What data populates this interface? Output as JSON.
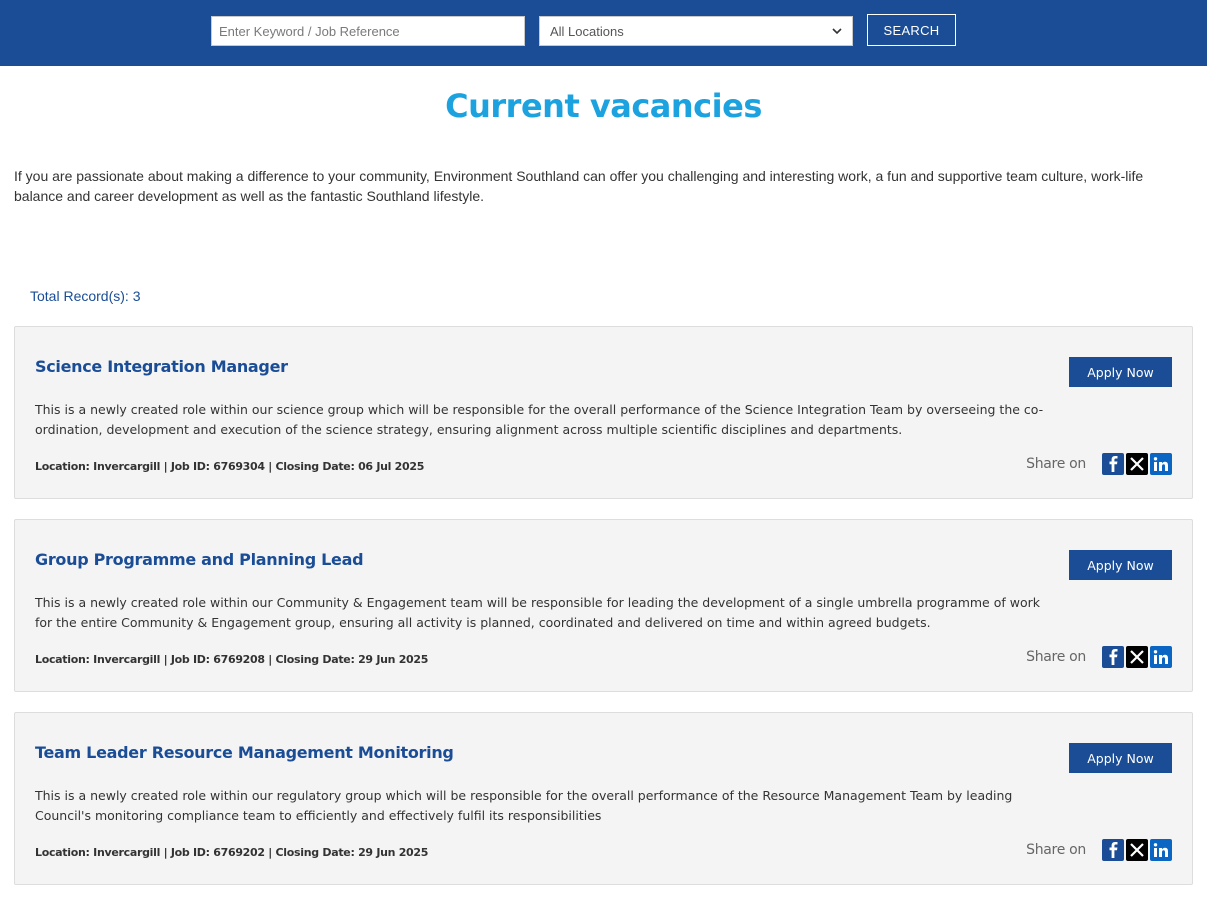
{
  "search": {
    "keyword_placeholder": "Enter Keyword / Job Reference",
    "location_selected": "All Locations",
    "button_label": "SEARCH"
  },
  "page": {
    "title": "Current vacancies",
    "intro": "If you are passionate about making a difference to your community, Environment Southland can offer you challenging and interesting work, a fun and supportive team culture, work-life balance and career development as well as the fantastic Southland lifestyle.",
    "total_records": "Total Record(s): 3"
  },
  "jobs": [
    {
      "title": "Science Integration Manager",
      "description": "This is a newly created role within our science group which will be responsible for the overall performance of the Science Integration Team by overseeing the co-ordination, development and execution of the science strategy, ensuring alignment across multiple scientific disciplines and departments.",
      "meta": "Location: Invercargill | Job ID: 6769304 | Closing Date: 06 Jul 2025",
      "apply_label": "Apply Now",
      "share_label": "Share on"
    },
    {
      "title": "Group Programme and Planning Lead",
      "description": "This is a newly created role within our Community & Engagement team will be responsible for leading the development of a single umbrella programme of work for the entire Community & Engagement group, ensuring all activity is planned, coordinated and delivered on time and within agreed budgets.",
      "meta": "Location: Invercargill | Job ID: 6769208 | Closing Date: 29 Jun 2025",
      "apply_label": "Apply Now",
      "share_label": "Share on"
    },
    {
      "title": "Team Leader Resource Management Monitoring",
      "description": "This is a newly created role within our regulatory group which will be responsible for the overall performance of the Resource Management Team by leading Council's monitoring compliance team to efficiently and effectively fulfil its responsibilities",
      "meta": "Location: Invercargill | Job ID: 6769202 | Closing Date: 29 Jun 2025",
      "apply_label": "Apply Now",
      "share_label": "Share on"
    }
  ],
  "social_icons": [
    "facebook-icon",
    "x-twitter-icon",
    "linkedin-icon"
  ],
  "colors": {
    "header_bg": "#1a4d96",
    "title_accent": "#1ba2df",
    "card_bg": "#f4f4f4",
    "primary": "#1a4d96"
  }
}
